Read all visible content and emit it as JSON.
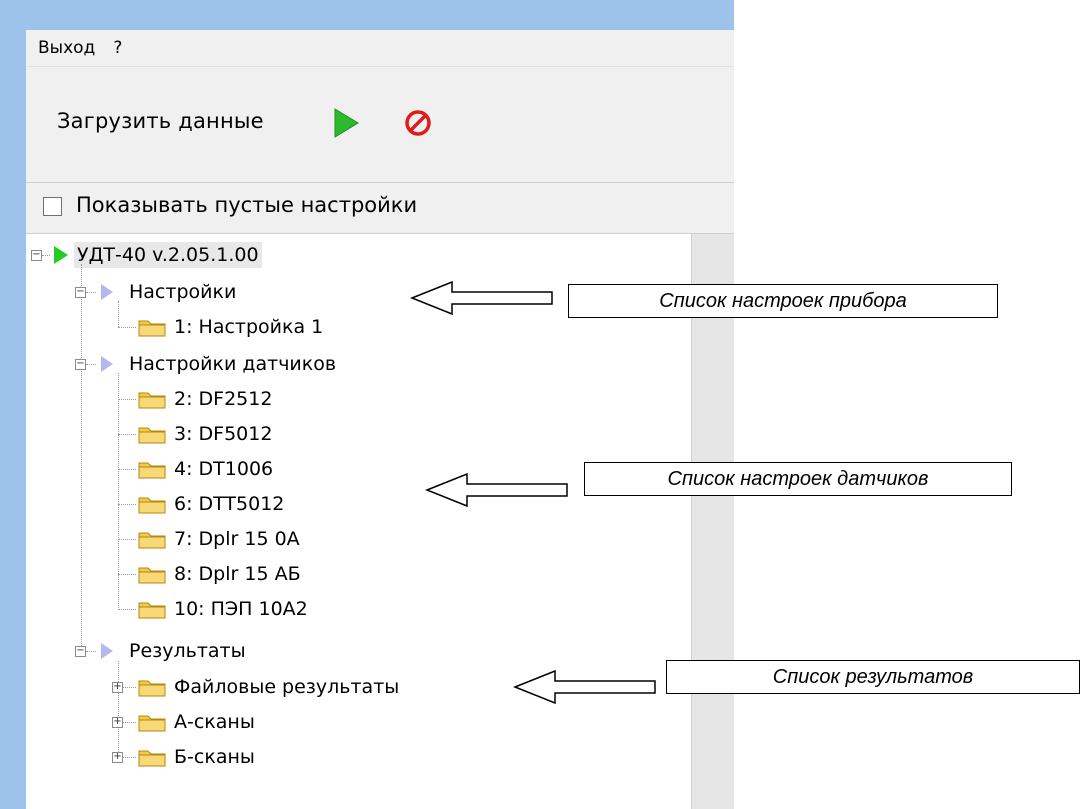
{
  "menu": {
    "items": [
      "Выход",
      "?"
    ]
  },
  "toolbar": {
    "load_label": "Загрузить данные",
    "play_icon": "play-icon",
    "stop_icon": "cancel-icon"
  },
  "options": {
    "show_empty_label": "Показывать пустые настройки",
    "show_empty_checked": false
  },
  "tree": {
    "root": "УДТ-40 v.2.05.1.00",
    "settings": {
      "label": "Настройки",
      "items": [
        "1: Настройка 1"
      ]
    },
    "sensors": {
      "label": "Настройки датчиков",
      "items": [
        "2: DF2512",
        "3: DF5012",
        "4: DT1006",
        "6: DTT5012",
        "7: Dplr 15 0A",
        "8: Dplr 15 АБ",
        "10: ПЭП 10А2"
      ]
    },
    "results": {
      "label": "Результаты",
      "items": [
        "Файловые результаты",
        "А-сканы",
        "Б-сканы"
      ]
    }
  },
  "callouts": {
    "settings": "Список настроек прибора",
    "sensors": "Список настроек датчиков",
    "results": "Список результатов"
  },
  "colors": {
    "window_frame": "#9ec3ea",
    "panel": "#f0f0f0",
    "play_green": "#2eb82e",
    "stop_red": "#e01b1b",
    "folder_yellow": "#f2c94c",
    "node_arrow": "#b4b8f0"
  }
}
